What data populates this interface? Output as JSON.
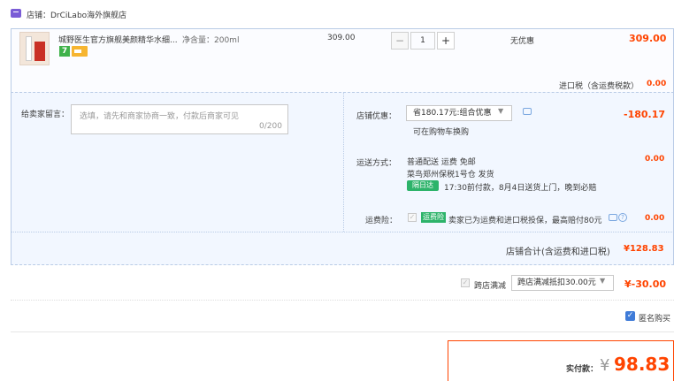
{
  "store": {
    "icon": "store-icon",
    "label": "店铺：DrCiLabo海外旗舰店"
  },
  "item": {
    "name": "城野医生官方旗舰美颜精华水细...",
    "spec": "净含量：200ml",
    "badges": {
      "seven": "7",
      "card_icon": "card-icon"
    },
    "unit_price": "309.00",
    "quantity": "1",
    "minus": "−",
    "plus": "+",
    "promo": "无优惠",
    "total": "309.00",
    "import_tax_label": "进口税（含运费税款）",
    "import_tax_value": "0.00"
  },
  "memo": {
    "label": "给卖家留言：",
    "placeholder": "选填，请先和商家协商一致，付款后商家可见",
    "count": "0/200"
  },
  "coupon": {
    "label": "店铺优惠：",
    "selected": "省180.17元:组合优惠",
    "hint": "可在购物车换购",
    "value": "-180.17"
  },
  "shipping": {
    "label": "运送方式：",
    "line1": "普通配送 运费 免邮",
    "line2": "菜鸟郑州保税1号仓  发货",
    "tag": "隔日达",
    "line3": "17:30前付款，8月4日送货上门，晚到必赔",
    "value": "0.00"
  },
  "insurance": {
    "label": "运费险：",
    "tag": "运费险",
    "text": "卖家已为运费和进口税投保，最高赔付80元",
    "value": "0.00"
  },
  "subtotal": {
    "label": "店铺合计(含运费和进口税)",
    "value": "¥128.83"
  },
  "cross_store": {
    "label": "跨店满减",
    "selected": "跨店满减抵扣30.00元",
    "value": "¥-30.00"
  },
  "anonymous": {
    "label": "匿名购买",
    "checked": true
  },
  "payment": {
    "label": "实付款：",
    "currency": "¥",
    "amount": "98.83"
  },
  "colors": {
    "accent": "#ff4400",
    "panel": "#f2f7ff",
    "border": "#b9cbe6",
    "tag_green": "#2db36a"
  }
}
